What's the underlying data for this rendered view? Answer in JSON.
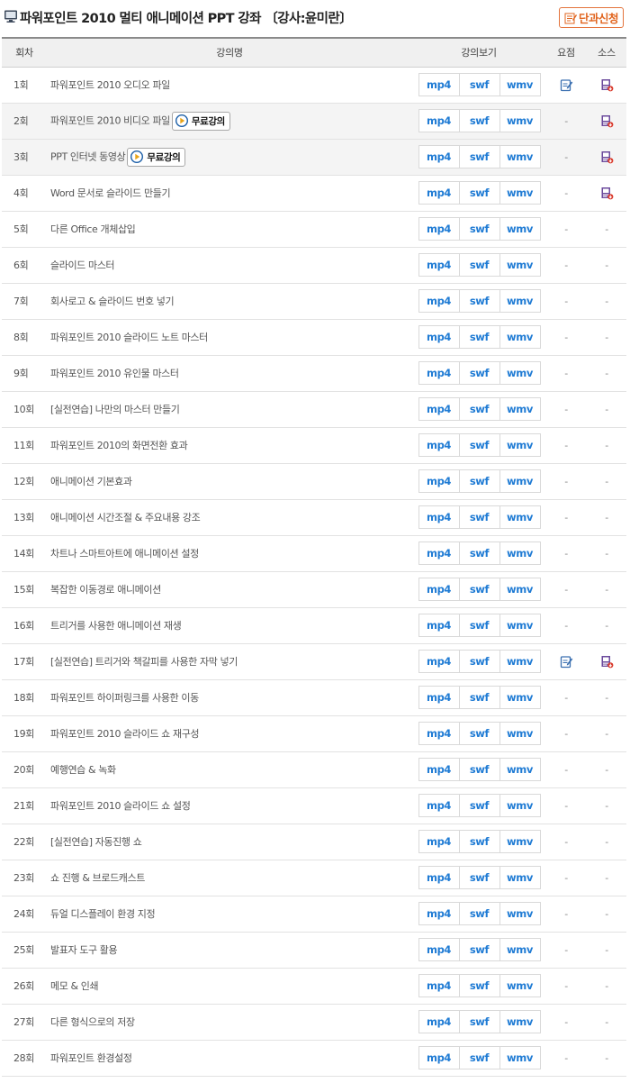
{
  "header": {
    "title": "파워포인트 2010 멀티 애니메이션 PPT 강좌 〔강사:윤미란〕",
    "apply_button": "단과신청"
  },
  "columns": {
    "round": "회차",
    "title": "강의명",
    "view": "강의보기",
    "summary": "요점",
    "source": "소스"
  },
  "formats": [
    "mp4",
    "swf",
    "wmv"
  ],
  "free_label": "무료강의",
  "dash": "-",
  "colors": {
    "link_blue": "#1f7bd4",
    "accent_orange": "#e1651f",
    "header_bg": "#f0f0f0",
    "shaded_row": "#f4f4f4"
  },
  "lectures": [
    {
      "num": "1회",
      "title": "파워포인트 2010 오디오 파일",
      "free": false,
      "summary": true,
      "source": true
    },
    {
      "num": "2회",
      "title": "파워포인트 2010 비디오 파일",
      "free": true,
      "summary": false,
      "source": true
    },
    {
      "num": "3회",
      "title": "PPT 인터넷 동영상",
      "free": true,
      "summary": false,
      "source": true
    },
    {
      "num": "4회",
      "title": "Word 문서로 슬라이드 만들기",
      "free": false,
      "summary": false,
      "source": true
    },
    {
      "num": "5회",
      "title": "다른 Office 개체삽입",
      "free": false,
      "summary": false,
      "source": false
    },
    {
      "num": "6회",
      "title": "슬라이드 마스터",
      "free": false,
      "summary": false,
      "source": false
    },
    {
      "num": "7회",
      "title": "회사로고 & 슬라이드 번호 넣기",
      "free": false,
      "summary": false,
      "source": false
    },
    {
      "num": "8회",
      "title": "파워포인트 2010 슬라이드 노트 마스터",
      "free": false,
      "summary": false,
      "source": false
    },
    {
      "num": "9회",
      "title": "파워포인트 2010 유인물 마스터",
      "free": false,
      "summary": false,
      "source": false
    },
    {
      "num": "10회",
      "title": "[실전연습] 나만의 마스터 만들기",
      "free": false,
      "summary": false,
      "source": false
    },
    {
      "num": "11회",
      "title": "파워포인트 2010의 화면전환 효과",
      "free": false,
      "summary": false,
      "source": false
    },
    {
      "num": "12회",
      "title": "애니메이션 기본효과",
      "free": false,
      "summary": false,
      "source": false
    },
    {
      "num": "13회",
      "title": "애니메이션 시간조절 & 주요내용 강조",
      "free": false,
      "summary": false,
      "source": false
    },
    {
      "num": "14회",
      "title": "차트나 스마트아트에 애니메이션 설정",
      "free": false,
      "summary": false,
      "source": false
    },
    {
      "num": "15회",
      "title": "복잡한 이동경로 애니메이션",
      "free": false,
      "summary": false,
      "source": false
    },
    {
      "num": "16회",
      "title": "트리거를 사용한 애니메이션 재생",
      "free": false,
      "summary": false,
      "source": false
    },
    {
      "num": "17회",
      "title": "[실전연습] 트리거와 책갈피를 사용한 자막 넣기",
      "free": false,
      "summary": true,
      "source": true
    },
    {
      "num": "18회",
      "title": "파워포인트 하이퍼링크를 사용한 이동",
      "free": false,
      "summary": false,
      "source": false
    },
    {
      "num": "19회",
      "title": "파워포인트 2010 슬라이드 쇼 재구성",
      "free": false,
      "summary": false,
      "source": false
    },
    {
      "num": "20회",
      "title": "예행연습 & 녹화",
      "free": false,
      "summary": false,
      "source": false
    },
    {
      "num": "21회",
      "title": "파워포인트 2010 슬라이드 쇼 설정",
      "free": false,
      "summary": false,
      "source": false
    },
    {
      "num": "22회",
      "title": "[실전연습] 자동진행 쇼",
      "free": false,
      "summary": false,
      "source": false
    },
    {
      "num": "23회",
      "title": "쇼 진행 & 브로드캐스트",
      "free": false,
      "summary": false,
      "source": false
    },
    {
      "num": "24회",
      "title": "듀얼 디스플레이 환경 지정",
      "free": false,
      "summary": false,
      "source": false
    },
    {
      "num": "25회",
      "title": "발표자 도구 활용",
      "free": false,
      "summary": false,
      "source": false
    },
    {
      "num": "26회",
      "title": "메모 & 인쇄",
      "free": false,
      "summary": false,
      "source": false
    },
    {
      "num": "27회",
      "title": "다른 형식으로의 저장",
      "free": false,
      "summary": false,
      "source": false
    },
    {
      "num": "28회",
      "title": "파워포인트 환경설정",
      "free": false,
      "summary": false,
      "source": false
    }
  ]
}
